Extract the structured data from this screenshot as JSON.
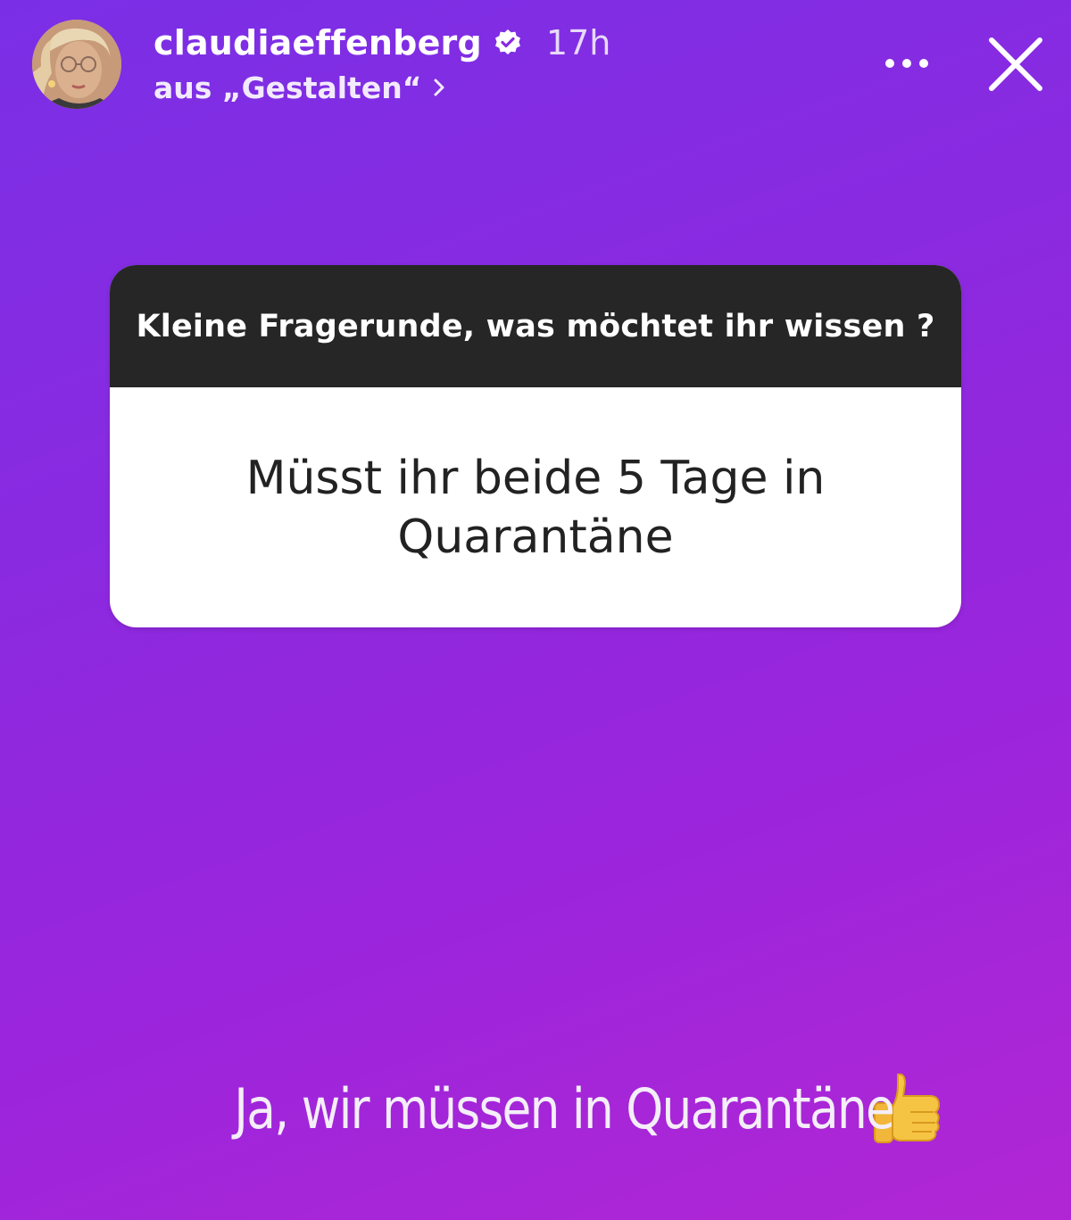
{
  "story": {
    "background_gradient": [
      "#7a2fe6",
      "#b126d4"
    ]
  },
  "header": {
    "avatar": "profile-photo",
    "username": "claudiaeffenberg",
    "verified": true,
    "time": "17h",
    "highlight_label": "aus „Gestalten“",
    "icons": [
      "verified-badge-icon",
      "chevron-right-icon",
      "more-options-icon",
      "close-icon"
    ]
  },
  "question_sticker": {
    "prompt": "Kleine Fragerunde, was möchtet ihr wissen ?",
    "answer": "Müsst ihr beide 5 Tage in Quarantäne",
    "prompt_bg": "#262626",
    "answer_bg": "#ffffff"
  },
  "reply": {
    "text": "Ja, wir müssen in Quarantäne",
    "emoji": "thumbs-up-icon"
  }
}
